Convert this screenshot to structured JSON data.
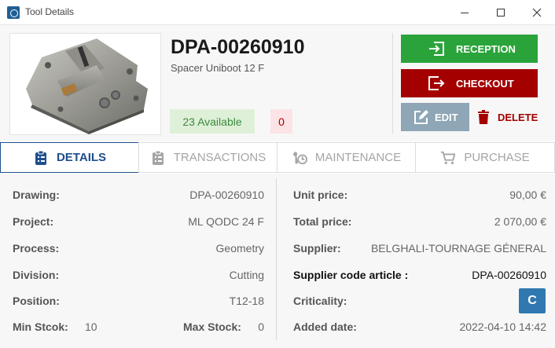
{
  "window": {
    "title": "Tool Details",
    "app_icon": "app-logo-icon",
    "controls": {
      "minimize": "minimize-icon",
      "maximize": "maximize-icon",
      "close": "close-icon"
    }
  },
  "tool": {
    "code": "DPA-00260910",
    "name": "Spacer Uniboot 12 F",
    "available_label": "23 Available",
    "reserved_count": "0",
    "image": "tool-photo"
  },
  "actions": {
    "reception": {
      "label": "RECEPTION",
      "icon": "reception-icon",
      "color": "#2aa43a"
    },
    "checkout": {
      "label": "CHECKOUT",
      "icon": "checkout-icon",
      "color": "#a40000"
    },
    "edit": {
      "label": "EDIT",
      "icon": "edit-icon",
      "color": "#8ea6b5"
    },
    "delete": {
      "label": "DELETE",
      "icon": "trash-icon",
      "color": "#a40000"
    }
  },
  "tabs": [
    {
      "label": "DETAILS",
      "icon": "clipboard-icon",
      "active": true
    },
    {
      "label": "TRANSACTIONS",
      "icon": "clipboard-list-icon",
      "active": false
    },
    {
      "label": "MAINTENANCE",
      "icon": "wrench-clock-icon",
      "active": false
    },
    {
      "label": "PURCHASE",
      "icon": "cart-icon",
      "active": false
    }
  ],
  "details": {
    "left": {
      "drawing": {
        "label": "Drawing:",
        "value": "DPA-00260910"
      },
      "project": {
        "label": "Project:",
        "value": "ML QODC 24 F"
      },
      "process": {
        "label": "Process:",
        "value": "Geometry"
      },
      "division": {
        "label": "Division:",
        "value": "Cutting"
      },
      "position": {
        "label": "Position:",
        "value": "T12-18"
      },
      "min_stock": {
        "label": "Min Stcok:",
        "value": "10"
      },
      "max_stock": {
        "label": "Max Stock:",
        "value": "0"
      }
    },
    "right": {
      "unit_price": {
        "label": "Unit price:",
        "value": "90,00 €"
      },
      "total_price": {
        "label": "Total price:",
        "value": "2 070,00 €"
      },
      "supplier": {
        "label": "Supplier:",
        "value": "BELGHALI-TOURNAGE GÉNERAL"
      },
      "supplier_code": {
        "label": "Supplier code article :",
        "value": "DPA-00260910"
      },
      "criticality": {
        "label": "Criticality:",
        "value": "C"
      },
      "added_date": {
        "label": "Added date:",
        "value": "2022-04-10 14:42"
      }
    }
  },
  "colors": {
    "accent": "#1f4e8c",
    "available_bg": "#dff0d8",
    "available_text": "#3c8a3c",
    "reserved_bg": "#fbe3e6",
    "criticality": "#2f78b0"
  }
}
